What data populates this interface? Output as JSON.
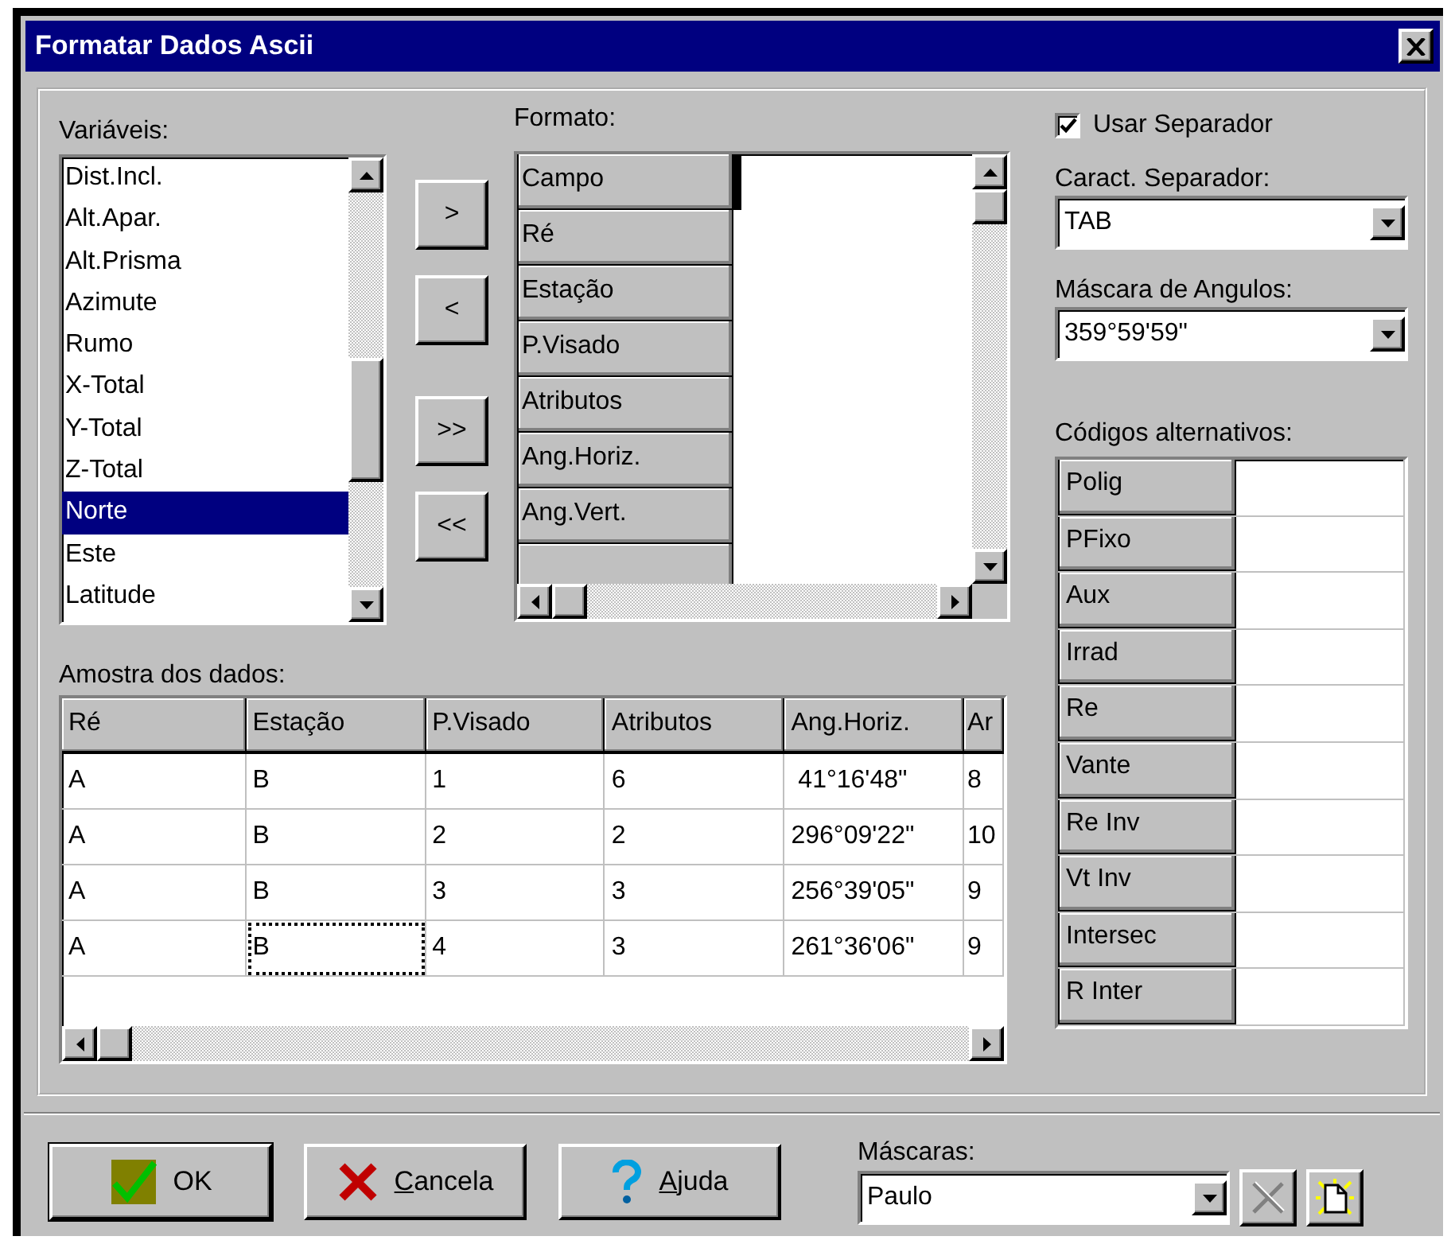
{
  "window": {
    "title": "Formatar Dados Ascii"
  },
  "variables": {
    "label": "Variáveis:",
    "items": [
      {
        "text": "Dist.Incl.",
        "selected": false
      },
      {
        "text": "Alt.Apar.",
        "selected": false
      },
      {
        "text": "Alt.Prisma",
        "selected": false
      },
      {
        "text": "Azimute",
        "selected": false
      },
      {
        "text": "Rumo",
        "selected": false
      },
      {
        "text": "X-Total",
        "selected": false
      },
      {
        "text": "Y-Total",
        "selected": false
      },
      {
        "text": "Z-Total",
        "selected": false
      },
      {
        "text": "Norte",
        "selected": true
      },
      {
        "text": "Este",
        "selected": false
      },
      {
        "text": "Latitude",
        "selected": false
      }
    ]
  },
  "move_buttons": [
    ">",
    "<",
    ">>",
    "<<"
  ],
  "format": {
    "label": "Formato:",
    "fields": [
      {
        "text": "Campo",
        "selected": true
      },
      {
        "text": "Ré",
        "selected": false
      },
      {
        "text": "Estação",
        "selected": false
      },
      {
        "text": "P.Visado",
        "selected": false
      },
      {
        "text": "Atributos",
        "selected": false
      },
      {
        "text": "Ang.Horiz.",
        "selected": false
      },
      {
        "text": "Ang.Vert.",
        "selected": false
      }
    ]
  },
  "use_separator": {
    "label": "Usar Separador",
    "checked": true
  },
  "separator": {
    "label": "Caract. Separador:",
    "value": "TAB"
  },
  "angle_mask": {
    "label": "Máscara de Angulos:",
    "value": "359°59'59\""
  },
  "alt_codes": {
    "label": "Códigos alternativos:",
    "rows": [
      "Polig",
      "PFixo",
      "Aux",
      "Irrad",
      "Re",
      "Vante",
      "Re Inv",
      "Vt Inv",
      "Intersec",
      "R Inter"
    ]
  },
  "sample": {
    "label": "Amostra dos dados:",
    "columns": [
      "Ré",
      "Estação",
      "P.Visado",
      "Atributos",
      "Ang.Horiz.",
      "Ar"
    ],
    "rows": [
      {
        "cells": [
          {
            "text": "A",
            "focused": false
          },
          {
            "text": "B",
            "focused": false
          },
          {
            "text": "1",
            "focused": false
          },
          {
            "text": "6",
            "focused": false
          },
          {
            "text": " 41°16'48\"",
            "focused": false
          },
          {
            "text": "8",
            "focused": false
          }
        ]
      },
      {
        "cells": [
          {
            "text": "A",
            "focused": false
          },
          {
            "text": "B",
            "focused": false
          },
          {
            "text": "2",
            "focused": false
          },
          {
            "text": "2",
            "focused": false
          },
          {
            "text": "296°09'22\"",
            "focused": false
          },
          {
            "text": "10",
            "focused": false
          }
        ]
      },
      {
        "cells": [
          {
            "text": "A",
            "focused": false
          },
          {
            "text": "B",
            "focused": false
          },
          {
            "text": "3",
            "focused": false
          },
          {
            "text": "3",
            "focused": false
          },
          {
            "text": "256°39'05\"",
            "focused": false
          },
          {
            "text": "9",
            "focused": false
          }
        ]
      },
      {
        "cells": [
          {
            "text": "A",
            "focused": false
          },
          {
            "text": "B",
            "focused": true
          },
          {
            "text": "4",
            "focused": false
          },
          {
            "text": "3",
            "focused": false
          },
          {
            "text": "261°36'06\"",
            "focused": false
          },
          {
            "text": "9",
            "focused": false
          }
        ]
      }
    ]
  },
  "buttons": [
    {
      "label": "OK",
      "kind": "ok",
      "underline_first": false
    },
    {
      "label": "Cancela",
      "kind": "cancel",
      "underline_first": true
    },
    {
      "label": "Ajuda",
      "kind": "help",
      "underline_first": true
    }
  ],
  "masks": {
    "label": "Máscaras:",
    "value": "Paulo",
    "delete_disabled": true
  }
}
